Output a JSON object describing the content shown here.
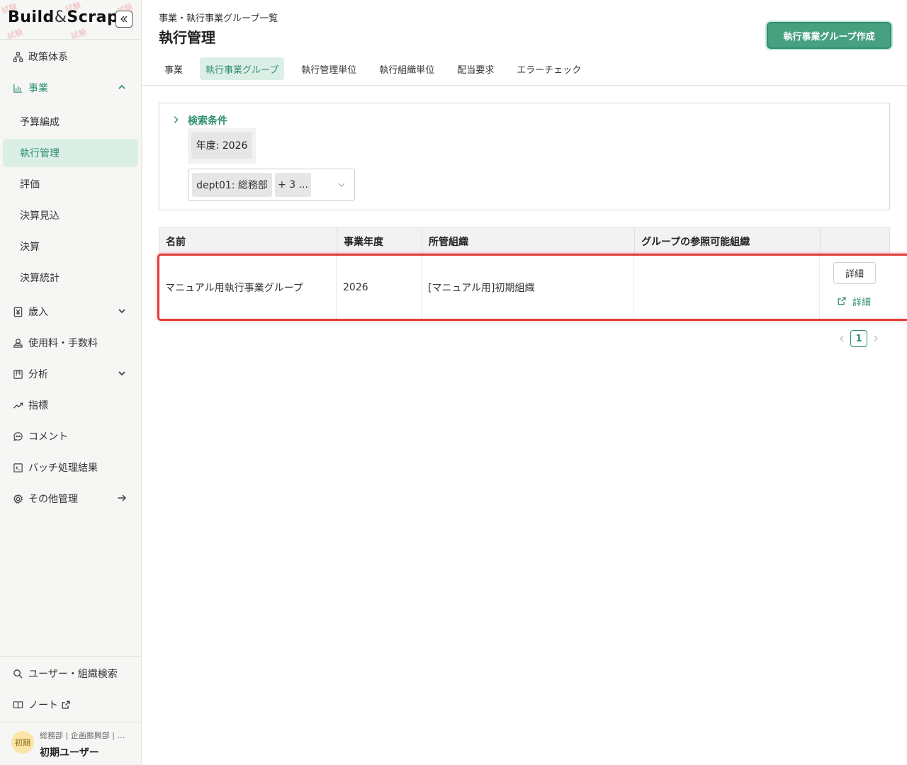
{
  "sidebar": {
    "logo": {
      "part1": "Build",
      "amp": "&",
      "part2": "Scrap",
      "stamp": "試験"
    },
    "collapse_icon": "double-chevron-left-icon",
    "items": [
      {
        "label": "政策体系",
        "icon": "hierarchy-icon"
      },
      {
        "label": "事業",
        "icon": "bar-chart-icon",
        "expanded": true
      },
      {
        "label": "歳入",
        "icon": "yen-icon"
      },
      {
        "label": "使用料・手数料",
        "icon": "coins-icon"
      },
      {
        "label": "分析",
        "icon": "board-icon"
      },
      {
        "label": "指標",
        "icon": "trend-icon"
      },
      {
        "label": "コメント",
        "icon": "comment-icon"
      },
      {
        "label": "バッチ処理結果",
        "icon": "terminal-icon"
      },
      {
        "label": "その他管理",
        "icon": "gear-icon"
      }
    ],
    "sub_items": [
      {
        "label": "予算編成"
      },
      {
        "label": "執行管理",
        "active": true
      },
      {
        "label": "評価"
      },
      {
        "label": "決算見込"
      },
      {
        "label": "決算"
      },
      {
        "label": "決算統計"
      }
    ],
    "bottom": [
      {
        "label": "ユーザー・組織検索",
        "icon": "search-icon"
      },
      {
        "label": "ノート",
        "icon": "book-icon"
      }
    ],
    "user": {
      "avatar": "初期",
      "org": "総務部 | 企画振興部 | …",
      "name": "初期ユーザー"
    }
  },
  "header": {
    "breadcrumb": "事業・執行事業グループ一覧",
    "title": "執行管理",
    "create_button": "執行事業グループ作成"
  },
  "tabs": [
    {
      "label": "事業"
    },
    {
      "label": "執行事業グループ",
      "active": true
    },
    {
      "label": "執行管理単位"
    },
    {
      "label": "執行組織単位"
    },
    {
      "label": "配当要求"
    },
    {
      "label": "エラーチェック"
    }
  ],
  "search": {
    "title": "検索条件",
    "year_tag": "年度: 2026",
    "dept_chip": "dept01: 総務部",
    "more_chip": "+ 3 ..."
  },
  "table": {
    "columns": [
      "名前",
      "事業年度",
      "所管組織",
      "グループの参照可能組織",
      ""
    ],
    "rows": [
      {
        "name": "マニュアル用執行事業グループ",
        "year": "2026",
        "org": "[マニュアル用]初期組織",
        "ref_orgs": "",
        "detail_button": "詳細",
        "detail_link": "詳細"
      }
    ]
  },
  "pagination": {
    "current": "1"
  },
  "colors": {
    "accent": "#2f8f6f",
    "accent_bg": "#dcefe6",
    "button": "#47a07f",
    "highlight": "#e23b3b"
  }
}
